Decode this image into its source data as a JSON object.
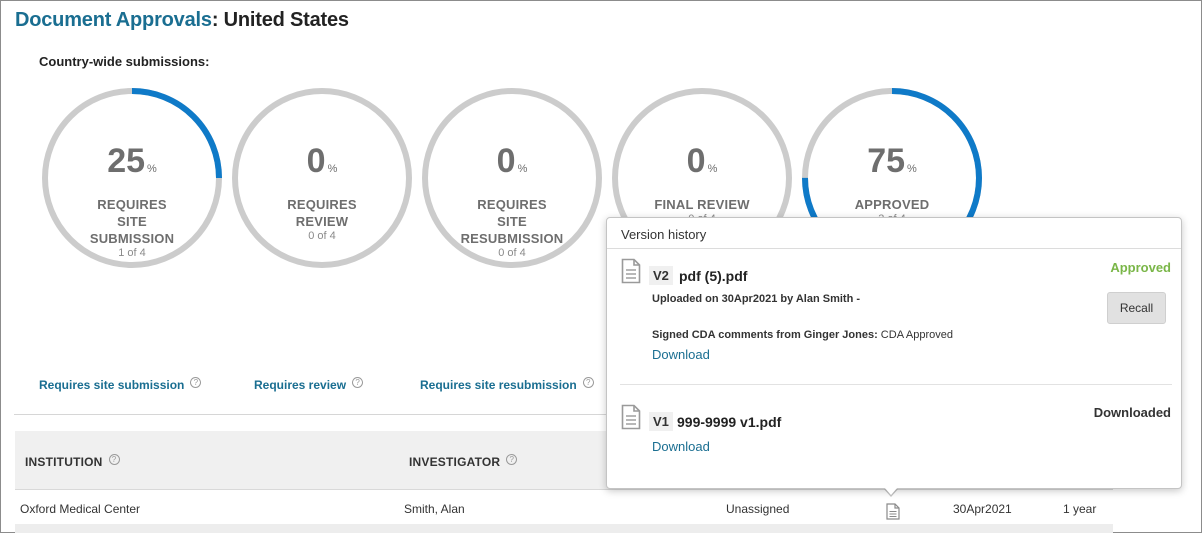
{
  "page": {
    "title_accent": "Document Approvals",
    "title_rest": ": United States",
    "subheading": "Country-wide submissions:"
  },
  "rings": [
    {
      "value": "25",
      "unit": "%",
      "label_lines": [
        "REQUIRES",
        "SITE",
        "SUBMISSION"
      ],
      "sub": "1 of 4",
      "fraction": 0.25
    },
    {
      "value": "0",
      "unit": "%",
      "label_lines": [
        "REQUIRES",
        "REVIEW"
      ],
      "sub": "0 of 4",
      "fraction": 0
    },
    {
      "value": "0",
      "unit": "%",
      "label_lines": [
        "REQUIRES",
        "SITE",
        "RESUBMISSION"
      ],
      "sub": "0 of 4",
      "fraction": 0
    },
    {
      "value": "0",
      "unit": "%",
      "label_lines": [
        "FINAL REVIEW"
      ],
      "sub": "0 of 4",
      "fraction": 0
    },
    {
      "value": "75",
      "unit": "%",
      "label_lines": [
        "APPROVED"
      ],
      "sub": "3 of 4",
      "fraction": 0.75
    }
  ],
  "colors": {
    "ring_track": "#cccccc",
    "ring_progress": "#0f7ac8",
    "accent": "#1a6e91",
    "approved": "#7ab648"
  },
  "filters": [
    {
      "label": "Requires site submission",
      "help": "?"
    },
    {
      "label": "Requires review",
      "help": "?"
    },
    {
      "label": "Requires site resubmission",
      "help": "?"
    }
  ],
  "table": {
    "headers": {
      "institution": "INSTITUTION",
      "investigator": "INVESTIGATOR",
      "help": "?"
    },
    "rows": [
      {
        "institution": "Oxford Medical Center",
        "investigator": "Smith, Alan",
        "assignee": "Unassigned",
        "doc_icon": "document-icon",
        "date": "30Apr2021",
        "duration": "1 year"
      }
    ]
  },
  "version_history": {
    "title": "Version history",
    "versions": [
      {
        "badge": "V2",
        "filename": "pdf (5).pdf",
        "uploaded": "Uploaded on 30Apr2021 by Alan Smith -",
        "comment_label": "Signed CDA comments from Ginger Jones:",
        "comment_text": " CDA Approved",
        "download": "Download",
        "status": "Approved",
        "action": "Recall"
      },
      {
        "badge": "V1",
        "filename": "999-9999 v1.pdf",
        "download": "Download",
        "status": "Downloaded"
      }
    ]
  }
}
